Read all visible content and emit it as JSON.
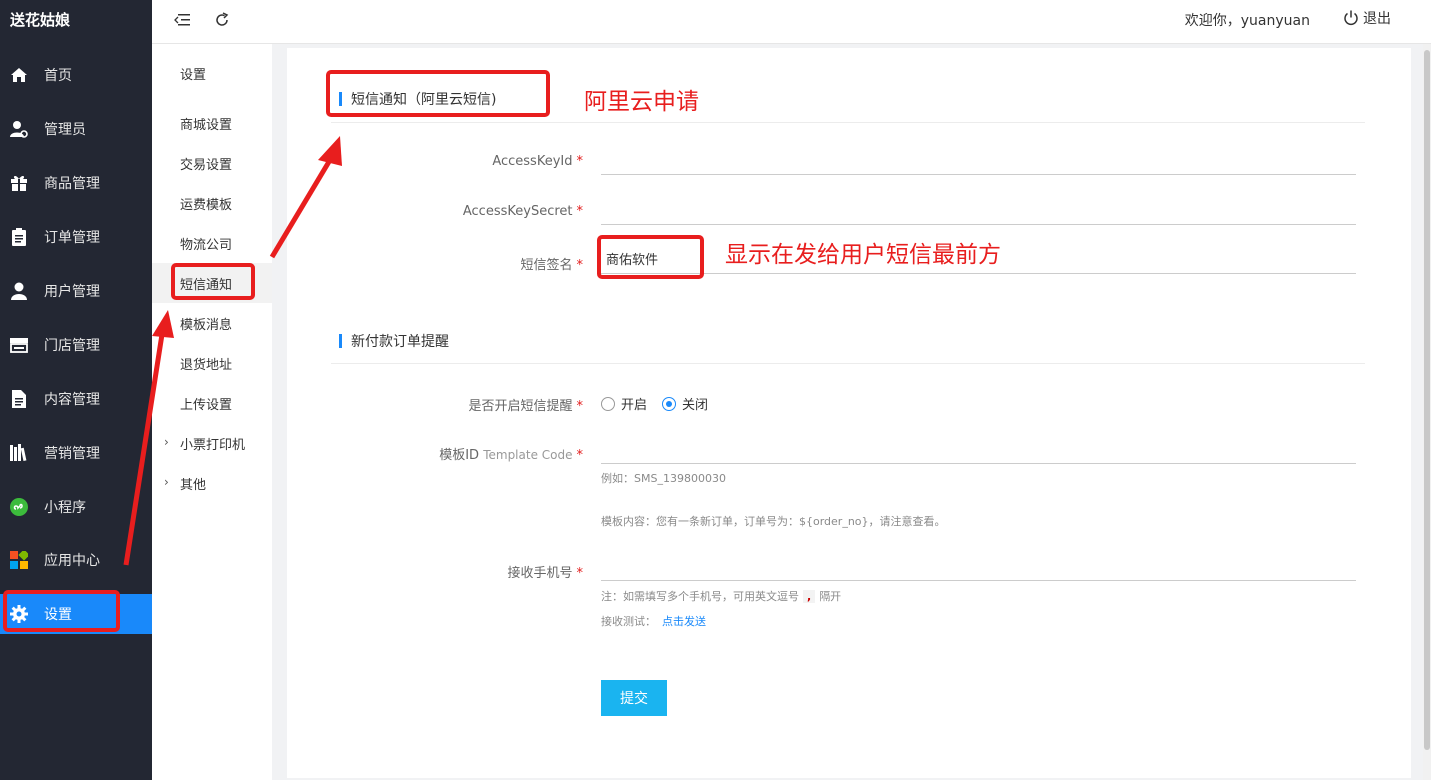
{
  "app": {
    "brand": "送花姑娘"
  },
  "sidebar": {
    "items": [
      {
        "label": "首页",
        "icon": "home-icon"
      },
      {
        "label": "管理员",
        "icon": "admin-user-icon"
      },
      {
        "label": "商品管理",
        "icon": "gift-icon"
      },
      {
        "label": "订单管理",
        "icon": "clipboard-icon"
      },
      {
        "label": "用户管理",
        "icon": "user-icon"
      },
      {
        "label": "门店管理",
        "icon": "store-icon"
      },
      {
        "label": "内容管理",
        "icon": "document-icon"
      },
      {
        "label": "营销管理",
        "icon": "books-icon"
      },
      {
        "label": "小程序",
        "icon": "miniprogram-icon"
      },
      {
        "label": "应用中心",
        "icon": "apps-icon"
      },
      {
        "label": "设置",
        "icon": "gear-icon",
        "active": true
      }
    ]
  },
  "header": {
    "welcome": "欢迎你，yuanyuan",
    "logout": "退出"
  },
  "subnav": {
    "title": "设置",
    "items": [
      {
        "label": "商城设置"
      },
      {
        "label": "交易设置"
      },
      {
        "label": "运费模板"
      },
      {
        "label": "物流公司"
      },
      {
        "label": "短信通知",
        "active": true
      },
      {
        "label": "模板消息"
      },
      {
        "label": "退货地址"
      },
      {
        "label": "上传设置"
      },
      {
        "label": "小票打印机",
        "expandable": true
      },
      {
        "label": "其他",
        "expandable": true
      }
    ]
  },
  "form": {
    "section1_title": "短信通知（阿里云短信)",
    "access_key_id": {
      "label": "AccessKeyId",
      "value": ""
    },
    "access_key_secret": {
      "label": "AccessKeySecret",
      "value": ""
    },
    "sms_signature": {
      "label": "短信签名",
      "value": "商佑软件"
    },
    "section2_title": "新付款订单提醒",
    "enable_sms": {
      "label": "是否开启短信提醒",
      "options": [
        "开启",
        "关闭"
      ],
      "selected": "关闭"
    },
    "template_id": {
      "label": "模板ID",
      "label_suffix": "Template Code",
      "value": "",
      "example": "例如：SMS_139800030",
      "content": "模板内容：您有一条新订单，订单号为：${order_no}，请注意查看。"
    },
    "receiver_phone": {
      "label": "接收手机号",
      "value": "",
      "note_prefix": "注：如需填写多个手机号，可用英文逗号",
      "note_comma": ",",
      "note_suffix": "隔开",
      "test_label": "接收测试：",
      "test_link": "点击发送"
    },
    "submit": "提交",
    "required_mark": "*"
  },
  "annotations": {
    "aliyun_apply": "阿里云申请",
    "signature_note": "显示在发给用户短信最前方",
    "color": "#e81e1e"
  },
  "colors": {
    "sidebar_bg": "#232733",
    "accent": "#1989fa",
    "submit_bg": "#1ab4f0"
  }
}
